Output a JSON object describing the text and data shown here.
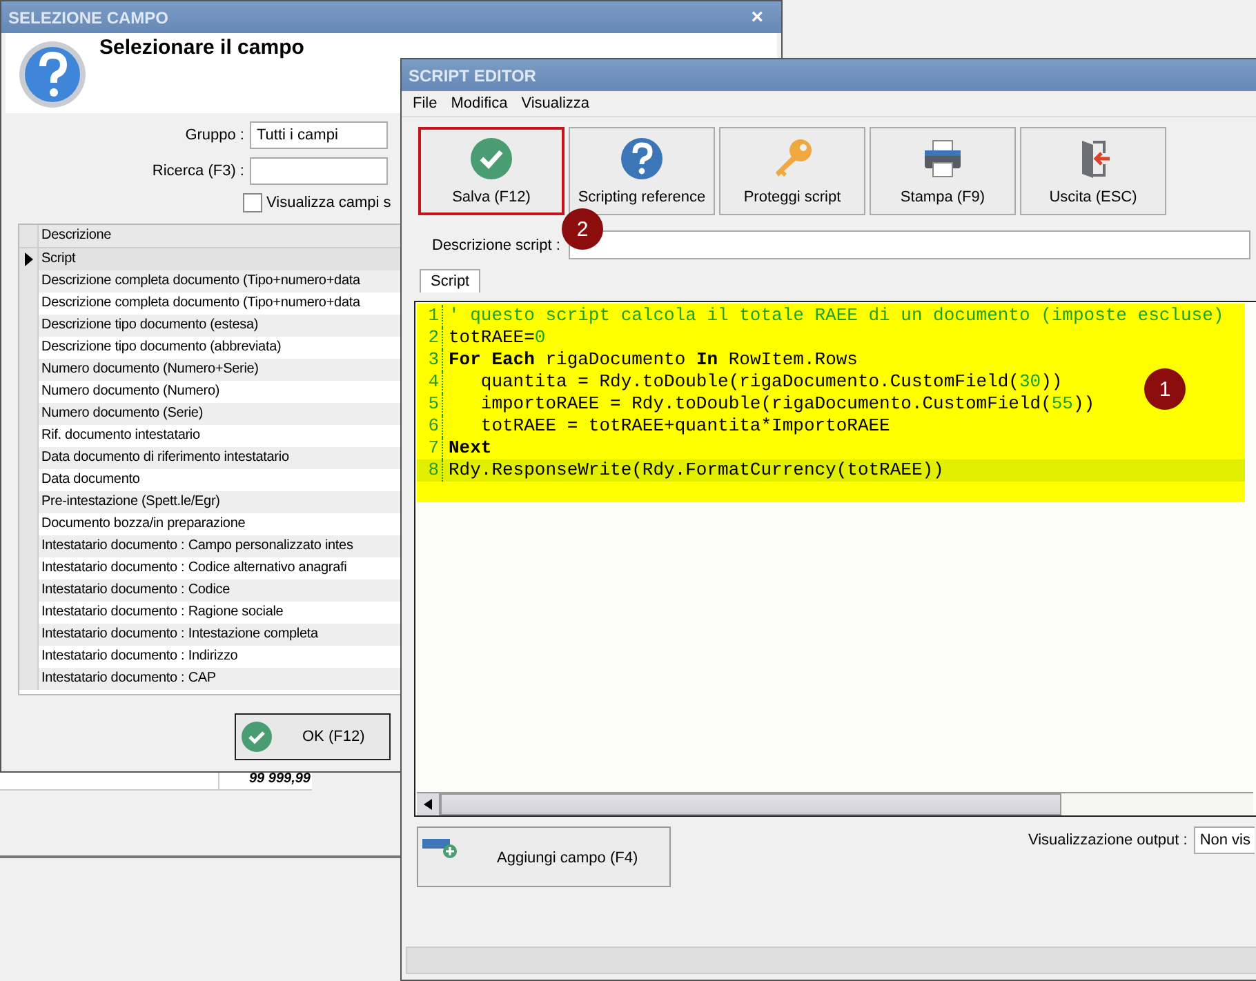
{
  "background_window": {
    "cell": "99 999,99"
  },
  "field_dialog": {
    "title": "SELEZIONE CAMPO",
    "close": "×",
    "heading": "Selezionare il campo",
    "group": {
      "label": "Gruppo :",
      "value": "Tutti i campi"
    },
    "search": {
      "label": "Ricerca (F3) :"
    },
    "show_fields": {
      "label": "Visualizza campi s",
      "checked": false
    },
    "table": {
      "columns": [
        "Descrizione"
      ],
      "rows": [
        {
          "text": "Script",
          "selected": true
        },
        {
          "text": "Descrizione completa documento (Tipo+numero+data",
          "selected": false
        },
        {
          "text": "Descrizione completa documento (Tipo+numero+data",
          "selected": false
        },
        {
          "text": "Descrizione tipo documento (estesa)",
          "selected": false
        },
        {
          "text": "Descrizione tipo documento (abbreviata)",
          "selected": false
        },
        {
          "text": "Numero documento (Numero+Serie)",
          "selected": false
        },
        {
          "text": "Numero documento (Numero)",
          "selected": false
        },
        {
          "text": "Numero documento (Serie)",
          "selected": false
        },
        {
          "text": "Rif. documento intestatario",
          "selected": false
        },
        {
          "text": "Data documento di riferimento intestatario",
          "selected": false
        },
        {
          "text": "Data documento",
          "selected": false
        },
        {
          "text": "Pre-intestazione (Spett.le/Egr)",
          "selected": false
        },
        {
          "text": "Documento bozza/in preparazione",
          "selected": false
        },
        {
          "text": "Intestatario documento : Campo personalizzato intes",
          "selected": false
        },
        {
          "text": "Intestatario documento : Codice alternativo anagrafi",
          "selected": false
        },
        {
          "text": "Intestatario documento : Codice",
          "selected": false
        },
        {
          "text": "Intestatario documento : Ragione sociale",
          "selected": false
        },
        {
          "text": "Intestatario documento : Intestazione completa",
          "selected": false
        },
        {
          "text": "Intestatario documento : Indirizzo",
          "selected": false
        },
        {
          "text": "Intestatario documento : CAP",
          "selected": false
        }
      ]
    },
    "ok_button": "OK (F12)"
  },
  "script_editor": {
    "title": "SCRIPT EDITOR",
    "menu": [
      "File",
      "Modifica",
      "Visualizza"
    ],
    "toolbar": [
      {
        "label": "Salva (F12)",
        "kind": "check",
        "highlighted": true
      },
      {
        "label": "Scripting reference",
        "kind": "help",
        "highlighted": false
      },
      {
        "label": "Proteggi script",
        "kind": "key",
        "highlighted": false
      },
      {
        "label": "Stampa (F9)",
        "kind": "printer",
        "highlighted": false
      },
      {
        "label": "Uscita (ESC)",
        "kind": "exit",
        "highlighted": false
      }
    ],
    "callouts": [
      "2",
      "1"
    ],
    "description": {
      "label": "Descrizione script :"
    },
    "tabs": [
      {
        "label": "Script",
        "selected": true
      }
    ],
    "code": [
      {
        "number": "1",
        "current": false,
        "tokens": [
          {
            "text": "' questo script calcola il totale RAEE di un documento (imposte escluse)",
            "kind": "comment"
          }
        ]
      },
      {
        "number": "2",
        "current": false,
        "tokens": [
          {
            "text": "totRAEE=",
            "kind": "plain"
          },
          {
            "text": "0",
            "kind": "number"
          }
        ]
      },
      {
        "number": "3",
        "current": false,
        "tokens": [
          {
            "text": "For Each",
            "kind": "keyword"
          },
          {
            "text": " rigaDocumento ",
            "kind": "plain"
          },
          {
            "text": "In",
            "kind": "keyword"
          },
          {
            "text": " RowItem.Rows",
            "kind": "plain"
          }
        ]
      },
      {
        "number": "4",
        "current": false,
        "tokens": [
          {
            "text": "   quantita = Rdy.toDouble(rigaDocumento.CustomField(",
            "kind": "plain"
          },
          {
            "text": "30",
            "kind": "number"
          },
          {
            "text": "))",
            "kind": "plain"
          }
        ]
      },
      {
        "number": "5",
        "current": false,
        "tokens": [
          {
            "text": "   importoRAEE = Rdy.toDouble(rigaDocumento.CustomField(",
            "kind": "plain"
          },
          {
            "text": "55",
            "kind": "number"
          },
          {
            "text": "))",
            "kind": "plain"
          }
        ]
      },
      {
        "number": "6",
        "current": false,
        "tokens": [
          {
            "text": "   totRAEE = totRAEE+quantita*ImportoRAEE",
            "kind": "plain"
          }
        ]
      },
      {
        "number": "7",
        "current": false,
        "tokens": [
          {
            "text": "Next",
            "kind": "keyword"
          }
        ]
      },
      {
        "number": "8",
        "current": true,
        "tokens": [
          {
            "text": "Rdy.ResponseWrite(Rdy.FormatCurrency(totRAEE))",
            "kind": "plain"
          }
        ]
      }
    ],
    "add_field_button": "Aggiungi campo (F4)",
    "output": {
      "label": "Visualizzazione output :",
      "value": "Non vis"
    }
  }
}
